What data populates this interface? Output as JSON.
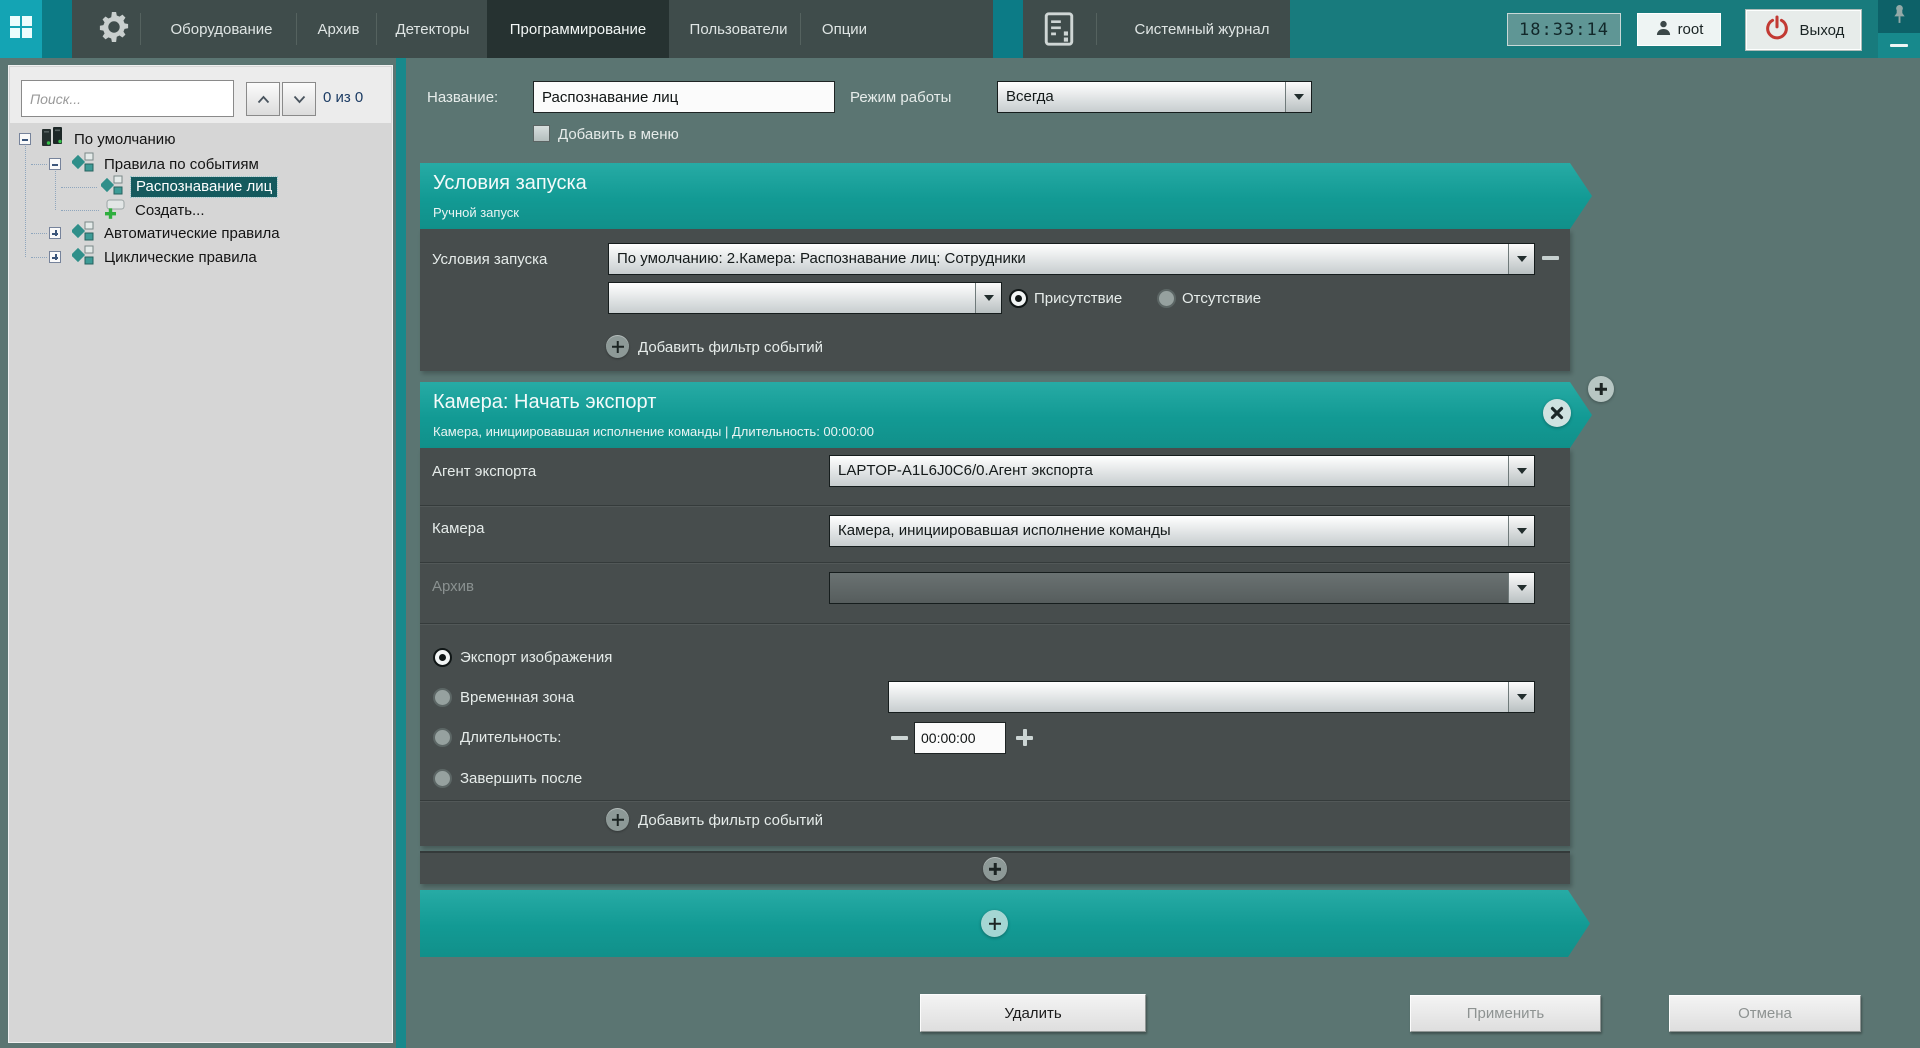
{
  "topbar": {
    "tabs": [
      {
        "label": "Оборудование"
      },
      {
        "label": "Архив"
      },
      {
        "label": "Детекторы"
      },
      {
        "label": "Программирование"
      },
      {
        "label": "Пользователи"
      },
      {
        "label": "Опции"
      }
    ],
    "active_tab": "Программирование",
    "journal_label": "Системный журнал",
    "time": "18:33:14",
    "user": "root",
    "logout_label": "Выход"
  },
  "sidebar": {
    "search_placeholder": "Поиск...",
    "counter": "0 из 0",
    "tree": [
      {
        "label": "По умолчанию"
      },
      {
        "label": "Правила по событиям"
      },
      {
        "label": "Распознавание лиц",
        "selected": true
      },
      {
        "label": "Создать..."
      },
      {
        "label": "Автоматические правила"
      },
      {
        "label": "Циклические правила"
      }
    ]
  },
  "editor": {
    "name_label": "Название:",
    "name_value": "Распознавание лиц",
    "mode_label": "Режим работы",
    "mode_value": "Всегда",
    "add_to_menu_label": "Добавить в меню",
    "trigger_banner": {
      "title": "Условия запуска",
      "subtitle": "Ручной запуск"
    },
    "trigger_panel": {
      "row_label": "Условия запуска",
      "condition_value": "По умолчанию: 2.Камера: Распознавание лиц: Сотрудники",
      "second_condition_value": "",
      "presence_label": "Присутствие",
      "absence_label": "Отсутствие",
      "add_filter_label": "Добавить фильтр событий"
    },
    "action_banner": {
      "title": "Камера: Начать экспорт",
      "subtitle": "Камера, инициировавшая исполнение команды | Длительность: 00:00:00"
    },
    "action_panel": {
      "agent_label": "Агент экспорта",
      "agent_value": "LAPTOP-A1L6J0C6/0.Агент экспорта",
      "camera_label": "Камера",
      "camera_value": "Камера, инициировавшая исполнение команды",
      "archive_label": "Архив",
      "archive_value": "",
      "export_image_label": "Экспорт изображения",
      "time_zone_label": "Временная зона",
      "time_zone_value": "",
      "duration_label": "Длительность:",
      "duration_value": "00:00:00",
      "finish_after_label": "Завершить после",
      "add_filter_label": "Добавить фильтр событий"
    }
  },
  "footer": {
    "delete_label": "Удалить",
    "apply_label": "Применить",
    "cancel_label": "Отмена"
  },
  "colors": {
    "accent_teal": "#129a94",
    "topbar_dark": "#3f4c4b",
    "topbar_teal": "#187b7d",
    "app_button_cyan": "#14a4b4",
    "main_background": "#5b7572",
    "panel_dark": "#474d4d",
    "sidebar_gray": "#d6d6d6",
    "selection_teal": "#155a5e",
    "logout_icon_red": "#c23a33"
  }
}
